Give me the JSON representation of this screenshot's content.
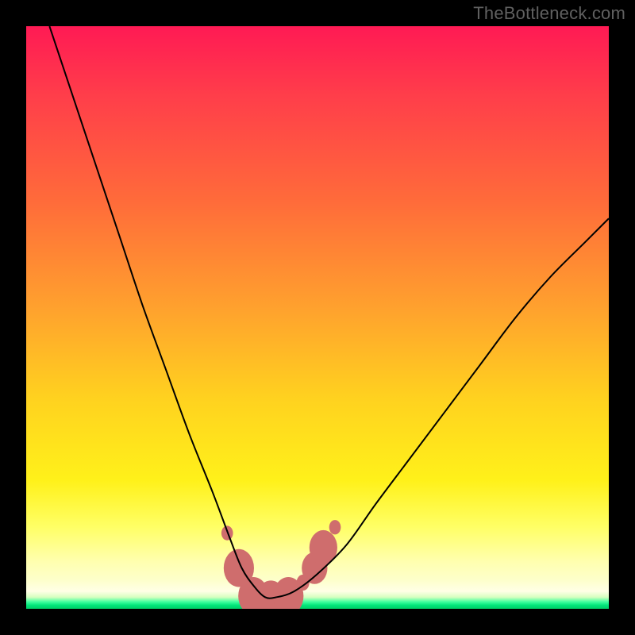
{
  "watermark": {
    "text": "TheBottleneck.com"
  },
  "chart_data": {
    "type": "line",
    "title": "",
    "xlabel": "",
    "ylabel": "",
    "xlim": [
      0,
      100
    ],
    "ylim": [
      0,
      100
    ],
    "grid": false,
    "legend": false,
    "background": "rainbow-vertical-gradient",
    "series": [
      {
        "name": "bottleneck-curve",
        "color": "#000000",
        "x": [
          4,
          8,
          12,
          16,
          20,
          24,
          28,
          32,
          35,
          37,
          39,
          41,
          43,
          46,
          50,
          55,
          60,
          66,
          72,
          78,
          84,
          90,
          96,
          100
        ],
        "values": [
          100,
          88,
          76,
          64,
          52,
          41,
          30,
          20,
          12,
          7,
          4,
          2,
          2,
          3,
          6,
          11,
          18,
          26,
          34,
          42,
          50,
          57,
          63,
          67
        ]
      }
    ],
    "markers": [
      {
        "name": "left-dot-upper",
        "x": 34.5,
        "y": 13.0,
        "r": 1.0,
        "color": "#cf6d6d"
      },
      {
        "name": "left-blob",
        "x": 36.5,
        "y": 7.0,
        "r": 2.6,
        "color": "#cf6d6d"
      },
      {
        "name": "bottom-blob-1",
        "x": 39.0,
        "y": 2.2,
        "r": 2.6,
        "color": "#cf6d6d"
      },
      {
        "name": "bottom-blob-2",
        "x": 42.0,
        "y": 1.6,
        "r": 2.6,
        "color": "#cf6d6d"
      },
      {
        "name": "bottom-blob-3",
        "x": 45.0,
        "y": 2.2,
        "r": 2.6,
        "color": "#cf6d6d"
      },
      {
        "name": "right-dot-1",
        "x": 47.5,
        "y": 4.5,
        "r": 1.1,
        "color": "#cf6d6d"
      },
      {
        "name": "right-blob-1",
        "x": 49.5,
        "y": 7.0,
        "r": 2.2,
        "color": "#cf6d6d"
      },
      {
        "name": "right-blob-2",
        "x": 51.0,
        "y": 10.5,
        "r": 2.4,
        "color": "#cf6d6d"
      },
      {
        "name": "right-dot-upper",
        "x": 53.0,
        "y": 14.0,
        "r": 1.0,
        "color": "#cf6d6d"
      }
    ]
  }
}
